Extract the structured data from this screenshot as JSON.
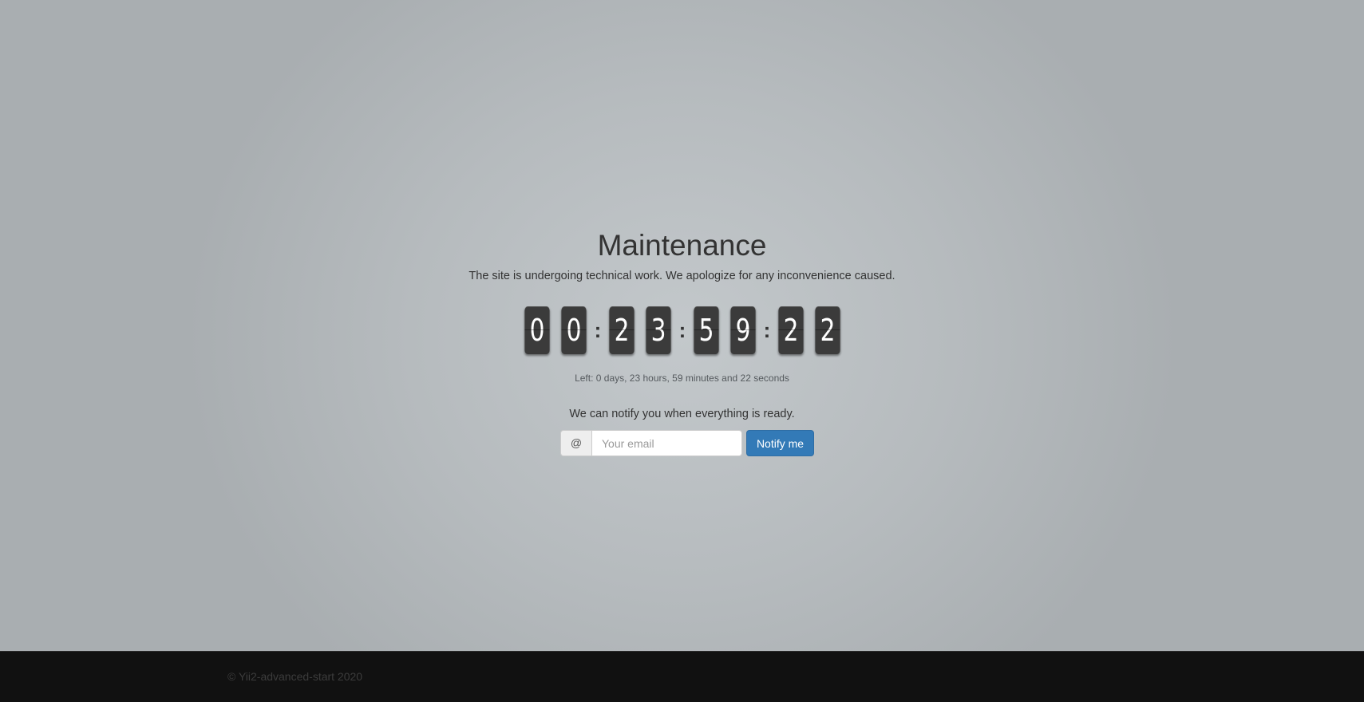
{
  "maintenance": {
    "title": "Maintenance",
    "subtitle": "The site is undergoing technical work. We apologize for any inconvenience caused.",
    "countdown": {
      "digits": [
        "0",
        "0",
        "2",
        "3",
        "5",
        "9",
        "2",
        "2"
      ],
      "separator": ":",
      "left_text": "Left: 0 days, 23 hours, 59 minutes and 22 seconds"
    },
    "notify": {
      "text": "We can notify you when everything is ready.",
      "addon": "@",
      "email_placeholder": "Your email",
      "email_value": "",
      "button_label": "Notify me"
    }
  },
  "footer": {
    "copyright": "© Yii2-advanced-start 2020"
  },
  "colors": {
    "button": "#337ab7",
    "digit_tile": "#3b3b3b",
    "footer_bg": "#111111"
  }
}
